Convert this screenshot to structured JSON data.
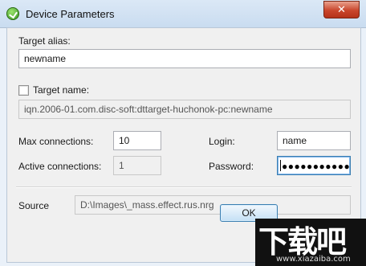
{
  "window": {
    "title": "Device Parameters",
    "close_glyph": "✕"
  },
  "form": {
    "target_alias_label": "Target alias:",
    "target_alias_value": "newname",
    "target_name_label": "Target name:",
    "target_name_checked": false,
    "target_name_value": "iqn.2006-01.com.disc-soft:dttarget-huchonok-pc:newname",
    "max_connections_label": "Max connections:",
    "max_connections_value": "10",
    "active_connections_label": "Active connections:",
    "active_connections_value": "1",
    "login_label": "Login:",
    "login_value": "name",
    "password_label": "Password:",
    "password_mask": "●●●●●●●●●●●●",
    "source_label": "Source",
    "source_value": "D:\\Images\\_mass.effect.rus.nrg"
  },
  "buttons": {
    "ok_label": "OK"
  },
  "watermark": {
    "brand": "下载吧",
    "url": "www.xiazaiba.com"
  },
  "icons": {
    "app": "green-check-icon",
    "close": "close-icon"
  }
}
